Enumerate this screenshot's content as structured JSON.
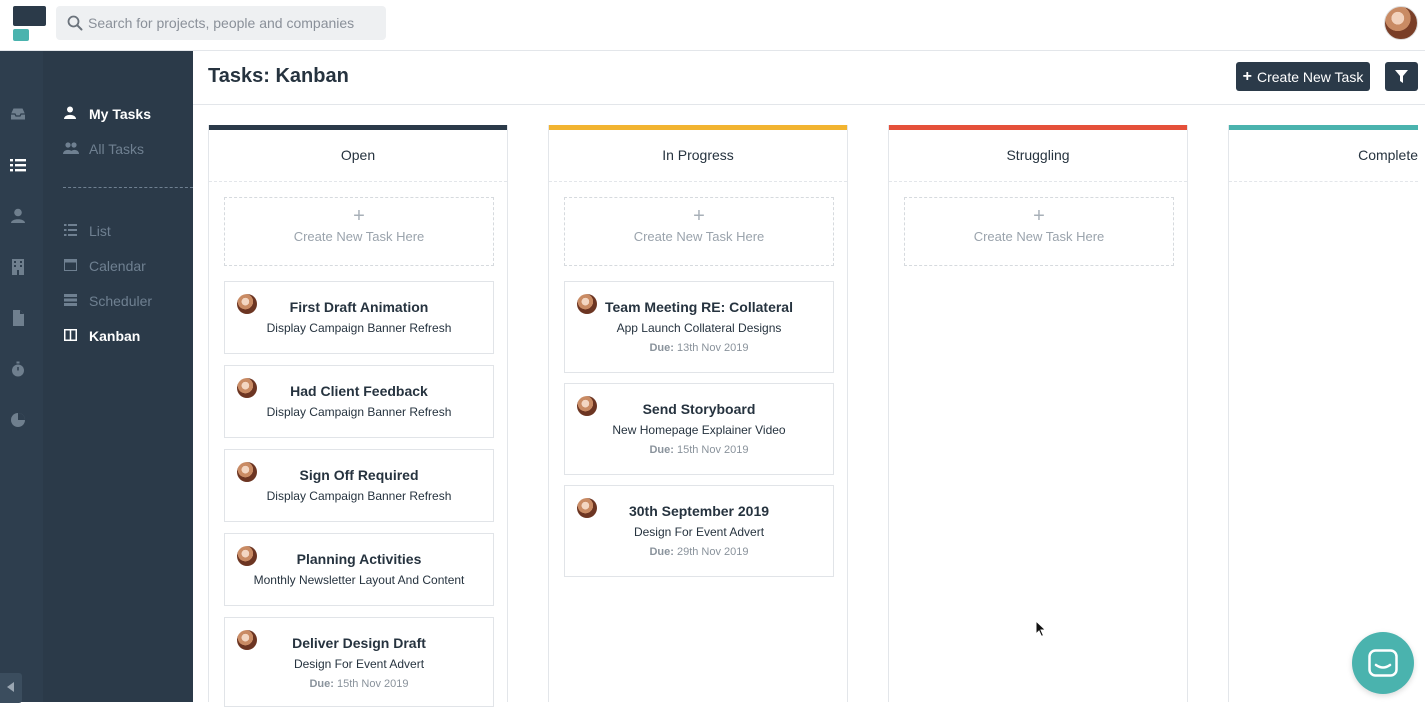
{
  "search": {
    "placeholder": "Search for projects, people and companies"
  },
  "rail": {
    "icons": [
      "inbox-icon",
      "list-icon",
      "person-icon",
      "building-icon",
      "document-icon",
      "stopwatch-icon",
      "pie-chart-icon"
    ]
  },
  "sidebar": {
    "my_tasks": "My Tasks",
    "all_tasks": "All Tasks",
    "views": [
      "List",
      "Calendar",
      "Scheduler",
      "Kanban"
    ]
  },
  "header": {
    "title": "Tasks: Kanban",
    "create_label": "Create New Task"
  },
  "colors": {
    "open": "#2b3a49",
    "in_progress": "#f2b430",
    "struggling": "#e5503a",
    "complete": "#4ab3ae"
  },
  "columns": [
    {
      "name": "Open",
      "create_label": "Create New Task Here",
      "cards": [
        {
          "title": "First Draft Animation",
          "project": "Display Campaign Banner Refresh"
        },
        {
          "title": "Had Client Feedback",
          "project": "Display Campaign Banner Refresh"
        },
        {
          "title": "Sign Off Required",
          "project": "Display Campaign Banner Refresh"
        },
        {
          "title": "Planning Activities",
          "project": "Monthly Newsletter Layout And Content"
        },
        {
          "title": "Deliver Design Draft",
          "project": "Design For Event Advert",
          "due_label": "Due:",
          "due": "15th Nov 2019"
        }
      ]
    },
    {
      "name": "In Progress",
      "create_label": "Create New Task Here",
      "cards": [
        {
          "title": "Team Meeting RE: Collateral",
          "project": "App Launch Collateral Designs",
          "due_label": "Due:",
          "due": "13th Nov 2019"
        },
        {
          "title": "Send Storyboard",
          "project": "New Homepage Explainer Video",
          "due_label": "Due:",
          "due": "15th Nov 2019"
        },
        {
          "title": "30th September 2019",
          "project": "Design For Event Advert",
          "due_label": "Due:",
          "due": "29th Nov 2019"
        }
      ]
    },
    {
      "name": "Struggling",
      "create_label": "Create New Task Here",
      "cards": []
    },
    {
      "name": "Complete",
      "cards": []
    }
  ]
}
